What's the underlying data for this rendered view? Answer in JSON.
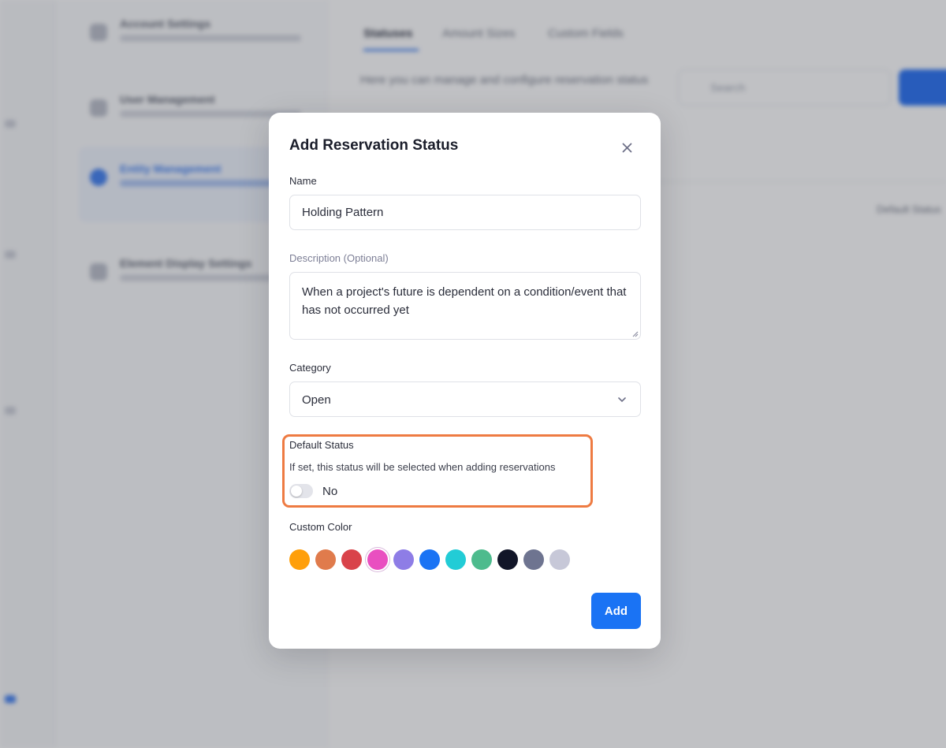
{
  "background": {
    "settings_nav": [
      {
        "title": "Account Settings"
      },
      {
        "title": "User Management"
      },
      {
        "title": "Entity Management",
        "active": true
      },
      {
        "title": "Element Display Settings"
      }
    ],
    "tabs": [
      "Statuses",
      "Amount Sizes",
      "Custom Fields"
    ],
    "description": "Here you can manage and configure reservation status",
    "search_placeholder": "Search",
    "column_label": "Default Status"
  },
  "modal": {
    "title": "Add Reservation Status",
    "close_icon": "close-icon",
    "name": {
      "label": "Name",
      "value": "Holding Pattern"
    },
    "description": {
      "label": "Description (Optional)",
      "value": "When a project's future is dependent on a condition/event that has not occurred yet"
    },
    "category": {
      "label": "Category",
      "selected": "Open",
      "chevron_icon": "chevron-down-icon"
    },
    "default_status": {
      "label": "Default Status",
      "help_text": "If set, this status will be selected when adding reservations",
      "toggle_on": false,
      "toggle_text": "No"
    },
    "custom_color": {
      "label": "Custom Color",
      "swatches": [
        "#ff9f0a",
        "#e07b4c",
        "#d9434a",
        "#e94fc0",
        "#8e7de6",
        "#1a73f4",
        "#22ccd6",
        "#4dbb8d",
        "#111528",
        "#6e7490",
        "#c7c8d8"
      ],
      "selected_index": 3
    },
    "submit_label": "Add",
    "highlight_color": "#ee7b42"
  }
}
